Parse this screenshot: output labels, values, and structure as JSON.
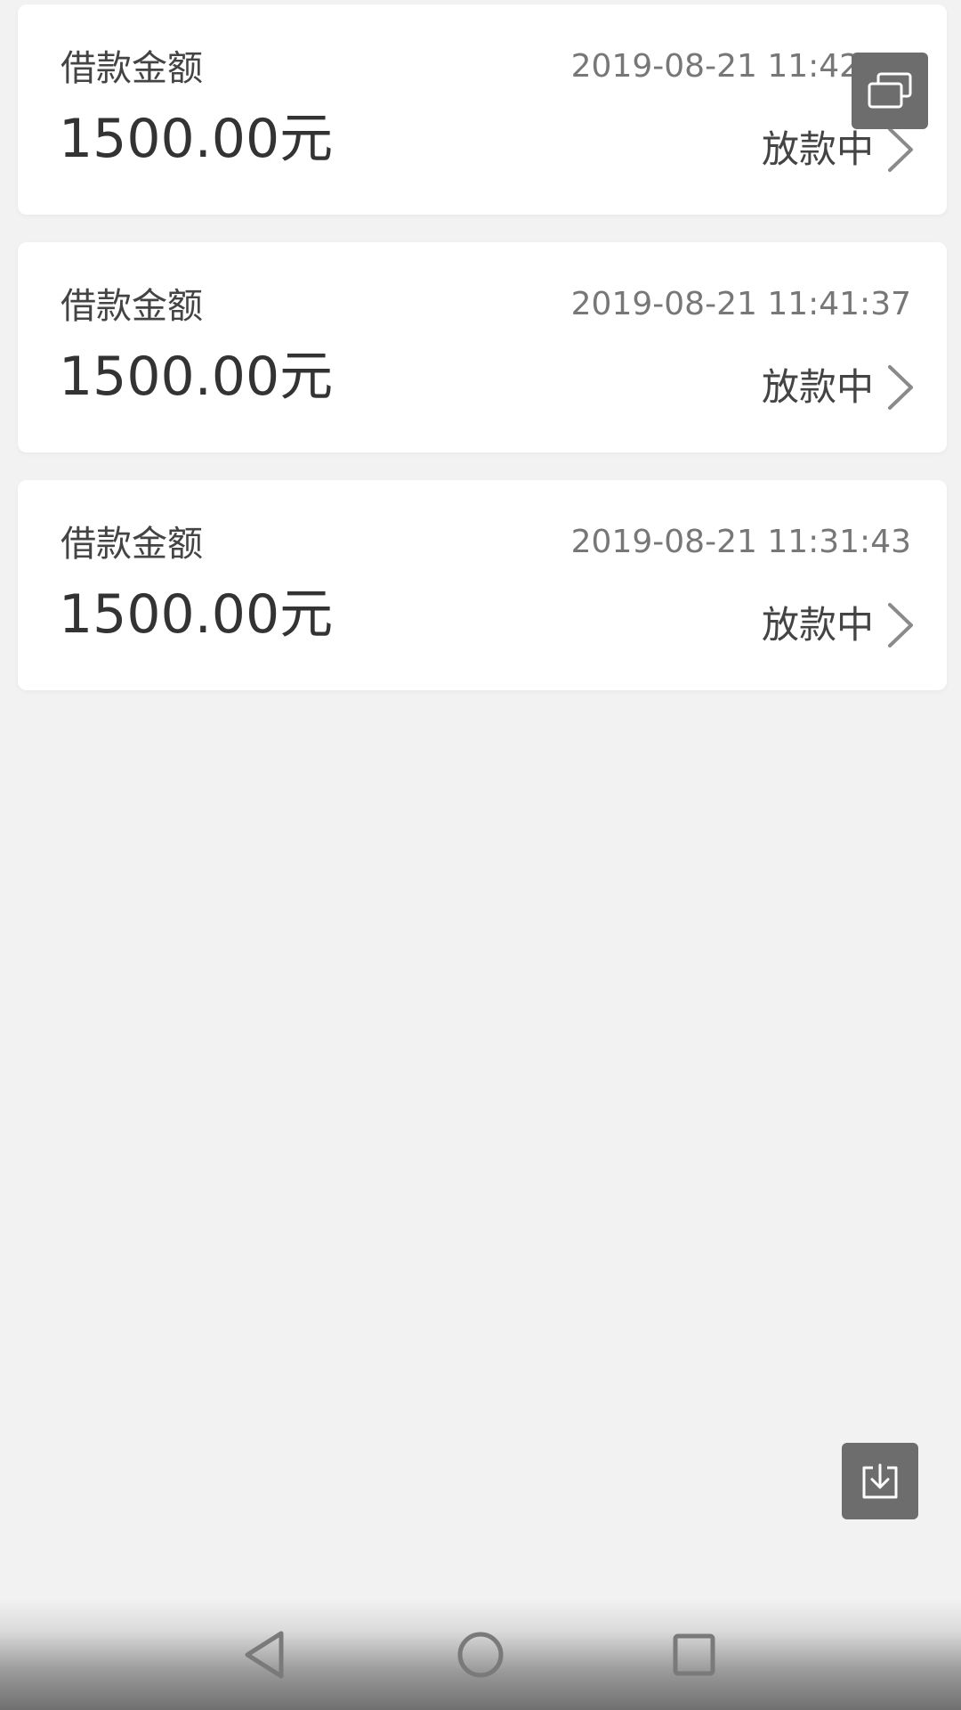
{
  "loans": [
    {
      "label": "借款金额",
      "amount": "1500.00元",
      "time": "2019-08-21 11:42:34",
      "status": "放款中"
    },
    {
      "label": "借款金额",
      "amount": "1500.00元",
      "time": "2019-08-21 11:41:37",
      "status": "放款中"
    },
    {
      "label": "借款金额",
      "amount": "1500.00元",
      "time": "2019-08-21 11:31:43",
      "status": "放款中"
    }
  ],
  "icons": {
    "chevron": "chevron-right-icon",
    "window": "multi-window-icon",
    "download": "download-icon",
    "back": "nav-back-icon",
    "home": "nav-home-icon",
    "recent": "nav-recent-icon"
  },
  "colors": {
    "background": "#f2f2f2",
    "card": "#ffffff",
    "text_primary": "#333333",
    "text_secondary": "#777777",
    "floating_button": "#6d6d6d"
  }
}
